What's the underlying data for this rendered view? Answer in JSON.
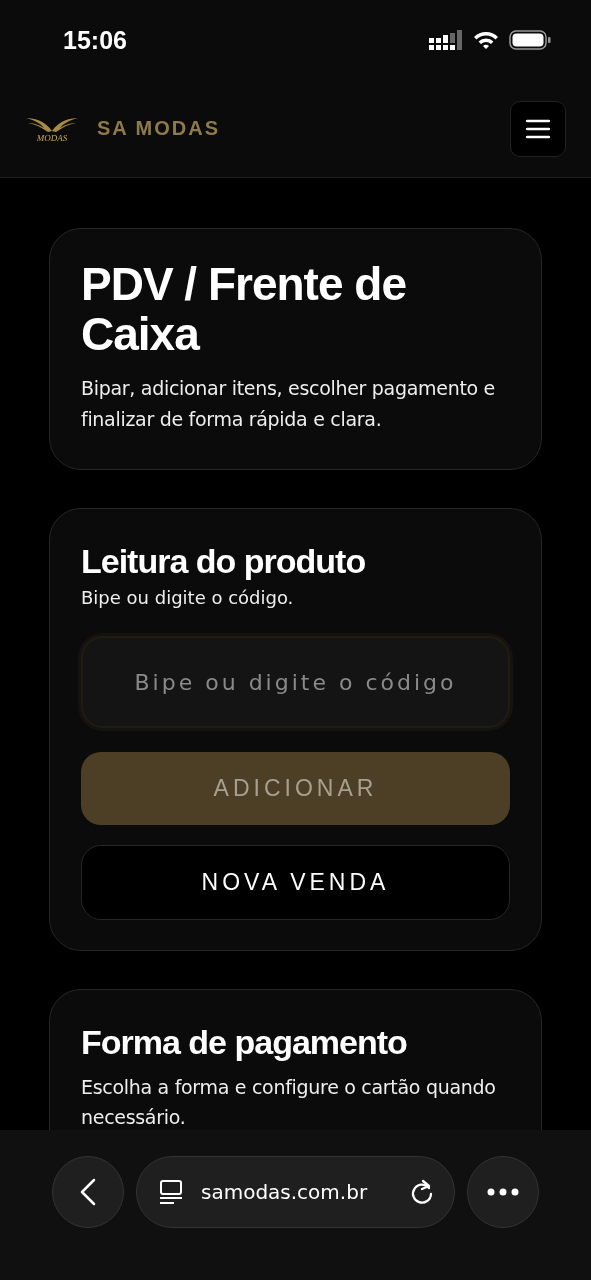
{
  "status_bar": {
    "time": "15:06"
  },
  "header": {
    "logo_text": "MODAS",
    "brand": "SA MODAS"
  },
  "intro": {
    "title": "PDV / Frente de Caixa",
    "description": "Bipar, adicionar itens, escolher pagamento e finalizar de forma rápida e clara."
  },
  "product_reading": {
    "title": "Leitura do produto",
    "subtitle": "Bipe ou digite o código.",
    "code_field": {
      "placeholder": "Bipe ou digite o código"
    },
    "buttons": [
      {
        "label": "ADICIONAR",
        "kind": "primary",
        "disabled": true
      },
      {
        "label": "NOVA VENDA",
        "kind": "secondary",
        "disabled": false
      }
    ]
  },
  "payment": {
    "title": "Forma de pagamento",
    "subtitle": "Escolha a forma e configure o cartão quando necessário."
  },
  "browser_bar": {
    "url": "samodas.com.br"
  }
}
